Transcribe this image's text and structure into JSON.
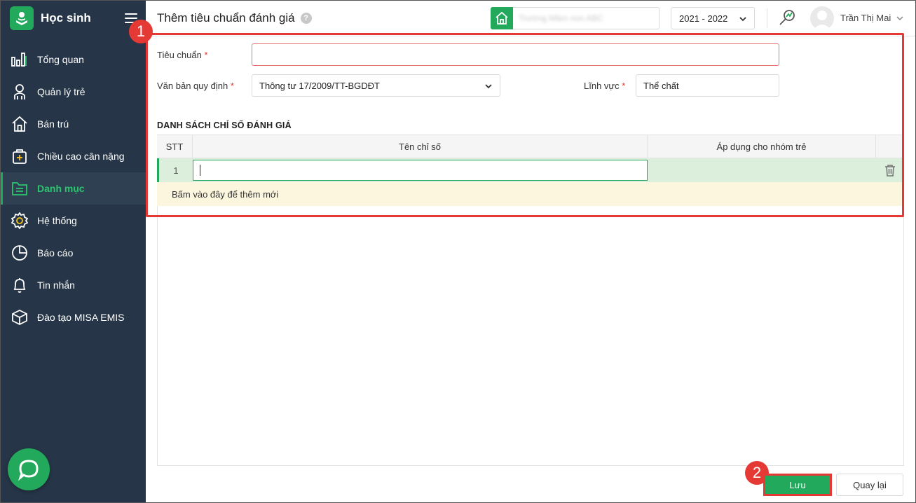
{
  "sidebar": {
    "app_title": "Học sinh",
    "items": [
      {
        "label": "Tổng quan",
        "icon": "chart-bars-icon"
      },
      {
        "label": "Quản lý trẻ",
        "icon": "child-icon"
      },
      {
        "label": "Bán trú",
        "icon": "house-icon"
      },
      {
        "label": "Chiều cao cân nặng",
        "icon": "medical-kit-icon"
      },
      {
        "label": "Danh mục",
        "icon": "folder-list-icon",
        "active": true
      },
      {
        "label": "Hệ thống",
        "icon": "gear-icon"
      },
      {
        "label": "Báo cáo",
        "icon": "pie-chart-icon"
      },
      {
        "label": "Tin nhắn",
        "icon": "bell-icon"
      },
      {
        "label": "Đào tạo MISA EMIS",
        "icon": "cube-icon"
      }
    ]
  },
  "topbar": {
    "page_title": "Thêm tiêu chuẩn đánh giá",
    "help_label": "?",
    "school_name": "Trường Mầm non ABC",
    "school_year": "2021 - 2022",
    "user_name": "Trần Thị Mai"
  },
  "form": {
    "standard_label": "Tiêu chuẩn",
    "standard_value": "",
    "doc_label": "Văn bản quy định",
    "doc_value": "Thông tư 17/2009/TT-BGDĐT",
    "field_label": "Lĩnh vực",
    "field_value": "Thể chất",
    "required_mark": "*"
  },
  "grid": {
    "section_title": "DANH SÁCH CHỈ SỐ ĐÁNH GIÁ",
    "columns": [
      "STT",
      "Tên chỉ số",
      "Áp dụng cho nhóm trẻ"
    ],
    "rows": [
      {
        "stt": "1",
        "name": "",
        "group": ""
      }
    ],
    "add_row_label": "Bấm vào đây để thêm mới"
  },
  "actions": {
    "save_label": "Lưu",
    "back_label": "Quay lại"
  },
  "callouts": {
    "one": "1",
    "two": "2"
  },
  "colors": {
    "sidebar_bg": "#263648",
    "accent_green": "#22a95b",
    "highlight_red": "#e53935"
  }
}
